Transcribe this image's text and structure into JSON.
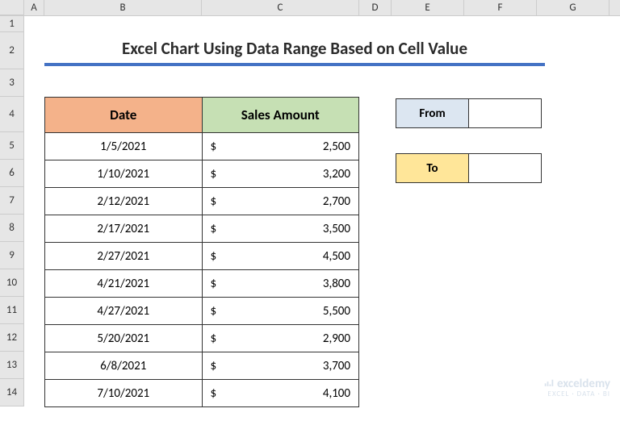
{
  "cols": [
    "A",
    "B",
    "C",
    "D",
    "E",
    "F",
    "G"
  ],
  "rows": [
    "1",
    "2",
    "3",
    "4",
    "5",
    "6",
    "7",
    "8",
    "9",
    "10",
    "11",
    "12",
    "13",
    "14"
  ],
  "title": "Excel Chart Using Data Range Based on Cell Value",
  "headers": {
    "date": "Date",
    "sales": "Sales Amount"
  },
  "currency_symbol": "$",
  "data": [
    {
      "date": "1/5/2021",
      "amount": "2,500"
    },
    {
      "date": "1/10/2021",
      "amount": "3,200"
    },
    {
      "date": "2/12/2021",
      "amount": "2,700"
    },
    {
      "date": "2/17/2021",
      "amount": "3,500"
    },
    {
      "date": "2/27/2021",
      "amount": "4,500"
    },
    {
      "date": "4/21/2021",
      "amount": "3,800"
    },
    {
      "date": "4/27/2021",
      "amount": "5,500"
    },
    {
      "date": "5/20/2021",
      "amount": "2,900"
    },
    {
      "date": "6/8/2021",
      "amount": "3,700"
    },
    {
      "date": "7/10/2021",
      "amount": "4,100"
    }
  ],
  "params": {
    "from_label": "From",
    "from_value": "",
    "to_label": "To",
    "to_value": ""
  },
  "watermark": {
    "brand": "exceldemy",
    "sub": "EXCEL · DATA · BI"
  }
}
